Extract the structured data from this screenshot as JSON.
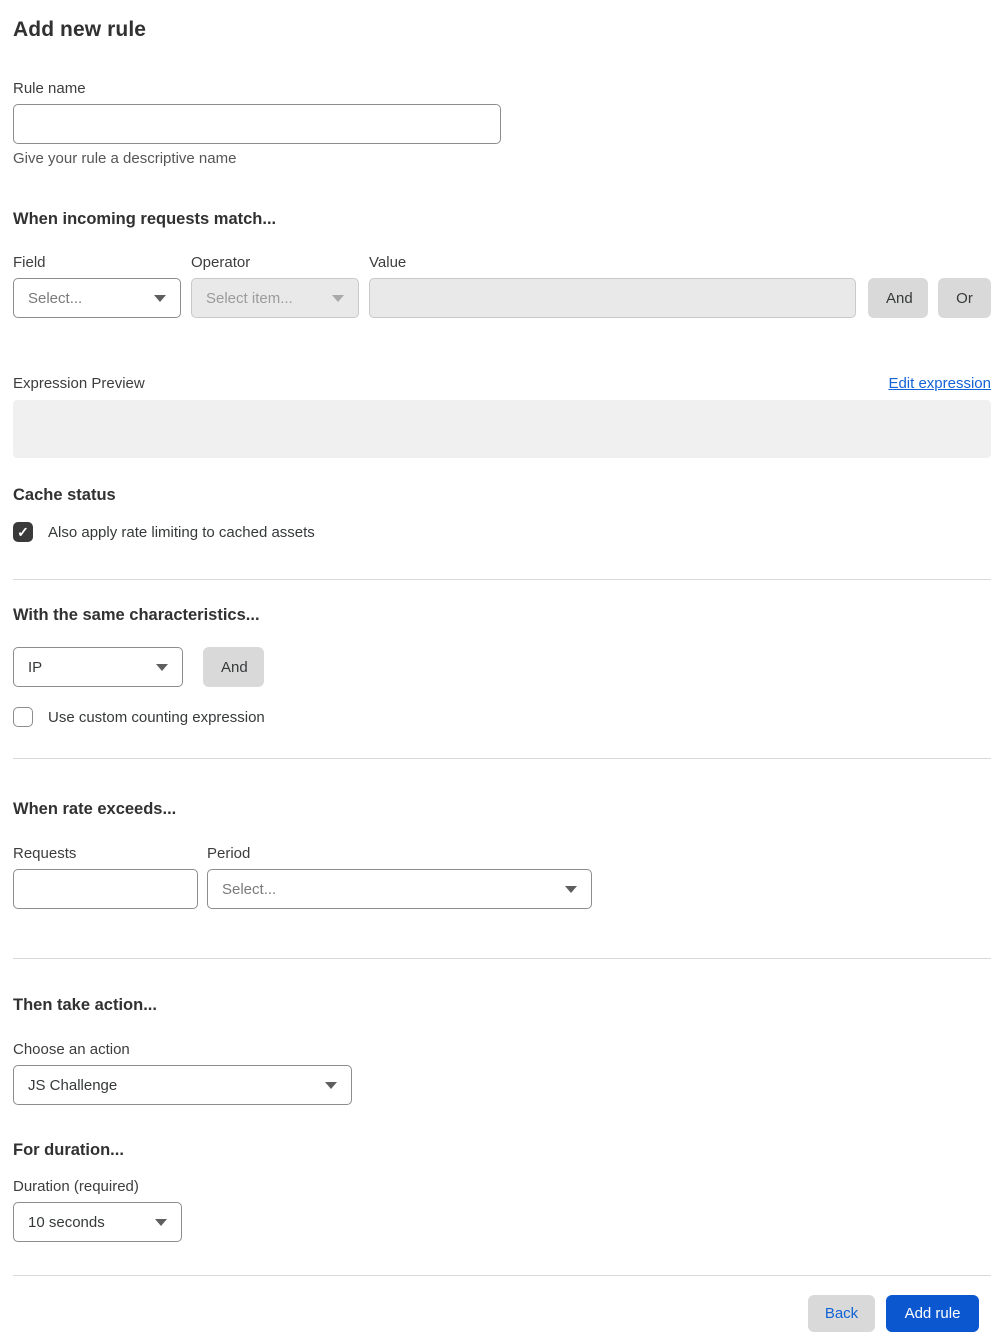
{
  "page": {
    "title": "Add new rule"
  },
  "colors": {
    "accent_blue": "#0a57d0",
    "button_gray": "#d9d9d9",
    "checkbox_dark": "#3a3a3a",
    "preview_gray": "#f0f0f0"
  },
  "rule_name": {
    "label": "Rule name",
    "value": "",
    "helper": "Give your rule a descriptive name"
  },
  "match": {
    "heading": "When incoming requests match...",
    "field": {
      "label": "Field",
      "value": "Select..."
    },
    "operator": {
      "label": "Operator",
      "value": "Select item..."
    },
    "value": {
      "label": "Value",
      "value": ""
    },
    "and_label": "And",
    "or_label": "Or"
  },
  "expression": {
    "label": "Expression Preview",
    "edit_link": "Edit expression",
    "content": ""
  },
  "cache": {
    "heading": "Cache status",
    "checkbox_label": "Also apply rate limiting to cached assets",
    "checked": true,
    "check_glyph": "✓"
  },
  "characteristics": {
    "heading": "With the same characteristics...",
    "select_value": "IP",
    "and_label": "And",
    "checkbox_label": "Use custom counting expression",
    "checked": false
  },
  "rate": {
    "heading": "When rate exceeds...",
    "requests": {
      "label": "Requests",
      "value": ""
    },
    "period": {
      "label": "Period",
      "value": "Select..."
    }
  },
  "action": {
    "heading": "Then take action...",
    "label": "Choose an action",
    "value": "JS Challenge"
  },
  "duration": {
    "heading": "For duration...",
    "label": "Duration (required)",
    "value": "10 seconds"
  },
  "footer": {
    "back_label": "Back",
    "add_label": "Add rule"
  }
}
